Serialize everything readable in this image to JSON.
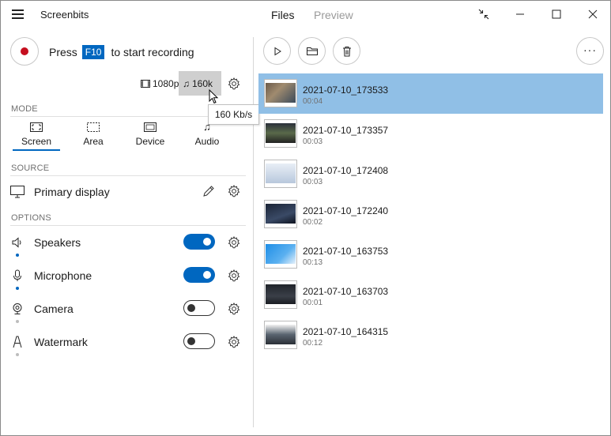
{
  "app": {
    "title": "Screenbits",
    "tabs": [
      {
        "label": "Files"
      },
      {
        "label": "Preview"
      }
    ]
  },
  "record": {
    "hint_prefix": "Press",
    "hotkey": "F10",
    "hint_suffix": "to start recording",
    "resolution": "1080p",
    "bitrate": "160k",
    "bitrate_tooltip": "160 Kb/s"
  },
  "mode": {
    "label": "MODE",
    "items": [
      {
        "label": "Screen"
      },
      {
        "label": "Area"
      },
      {
        "label": "Device"
      },
      {
        "label": "Audio"
      }
    ],
    "selected": "Screen"
  },
  "source": {
    "label": "SOURCE",
    "value": "Primary display"
  },
  "options": {
    "label": "OPTIONS",
    "items": [
      {
        "label": "Speakers",
        "enabled": true,
        "icon": "speaker-icon"
      },
      {
        "label": "Microphone",
        "enabled": true,
        "icon": "microphone-icon"
      },
      {
        "label": "Camera",
        "enabled": false,
        "icon": "camera-icon"
      },
      {
        "label": "Watermark",
        "enabled": false,
        "icon": "watermark-icon"
      }
    ]
  },
  "colors": {
    "accent": "#0067c0",
    "selected_row": "#90bfe6",
    "record": "#c50f1f"
  },
  "files": [
    {
      "name": "2021-07-10_173533",
      "duration": "00:04",
      "selected": true
    },
    {
      "name": "2021-07-10_173357",
      "duration": "00:03",
      "selected": false
    },
    {
      "name": "2021-07-10_172408",
      "duration": "00:03",
      "selected": false
    },
    {
      "name": "2021-07-10_172240",
      "duration": "00:02",
      "selected": false
    },
    {
      "name": "2021-07-10_163753",
      "duration": "00:13",
      "selected": false
    },
    {
      "name": "2021-07-10_163703",
      "duration": "00:01",
      "selected": false
    },
    {
      "name": "2021-07-10_164315",
      "duration": "00:12",
      "selected": false
    }
  ]
}
